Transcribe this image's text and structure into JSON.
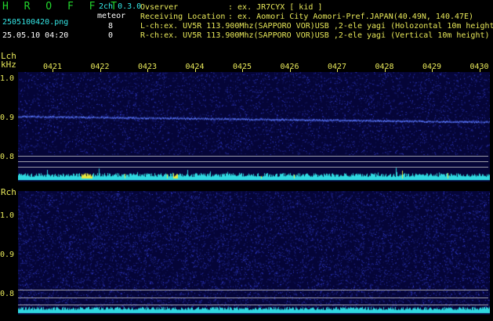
{
  "header": {
    "app_title": "H R O F F T",
    "filename": "2505100420.png",
    "datetime": "25.05.10 04:20",
    "channels": "2ch 0.3.0",
    "meteor_label": "meteor",
    "meteor_l_count": "8",
    "meteor_r_count": "0"
  },
  "info": {
    "observer_label": "Ovserver",
    "observer_value": ": ex. JR7CYX [ kid ]",
    "location_label": "Receiving Location",
    "location_value": ": ex. Aomori City Aomori-Pref.JAPAN(40.49N, 140.47E)",
    "lch_line": "L-ch:ex. UV5R 113.900Mhz(SAPPORO VOR)USB ,2-ele yagi (Holozontal 10m height",
    "rch_line": "R-ch:ex. UV5R 113.900Mhz(SAPPORO VOR)USB ,2-ele yagi (Vertical 10m height)"
  },
  "lch": {
    "label": "Lch",
    "unit": "kHz",
    "y_labels": [
      "1.0",
      "0.9",
      "0.8"
    ]
  },
  "rch": {
    "label": "Rch",
    "y_labels": [
      "1.0",
      "0.9",
      "0.8"
    ]
  },
  "time_axis": {
    "labels": [
      "0421",
      "0422",
      "0423",
      "0424",
      "0425",
      "0426",
      "0427",
      "0428",
      "0429",
      "0430"
    ]
  },
  "colors": {
    "green_logo": "#22d32c",
    "cyan": "#34e6e6",
    "yellow": "#e8e85a",
    "background": "#000000",
    "spectrum_bg": "#06063a"
  }
}
